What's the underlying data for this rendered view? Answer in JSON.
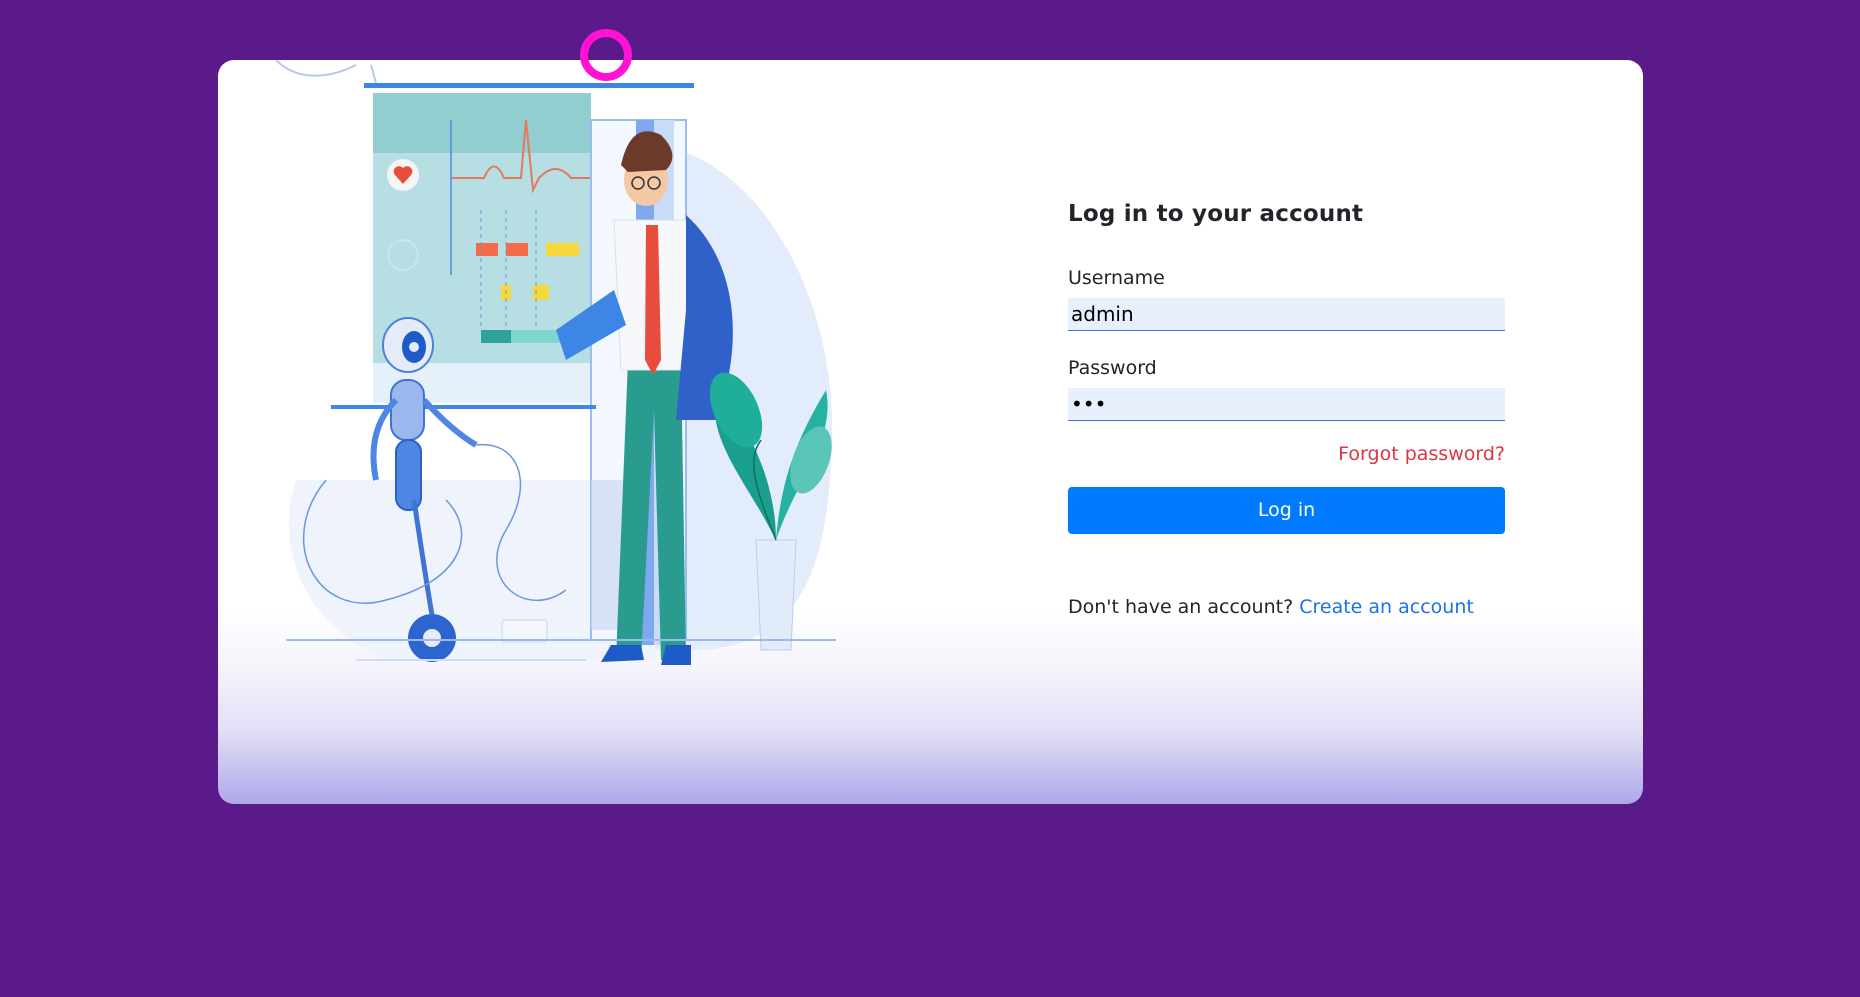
{
  "login": {
    "title": "Log in to your account",
    "username_label": "Username",
    "username_value": "admin",
    "password_label": "Password",
    "password_value": "•••",
    "forgot_label": "Forgot password?",
    "submit_label": "Log in",
    "signup_prompt": "Don't have an account?",
    "signup_link": "Create an account"
  },
  "colors": {
    "page_background": "#5a1a8a",
    "primary_button": "#007bff",
    "forgot_link": "#dc3545",
    "signup_link": "#1a73e8",
    "input_background": "#e8f0fe"
  },
  "illustration": {
    "icon": "doctor-robot-illustration"
  }
}
